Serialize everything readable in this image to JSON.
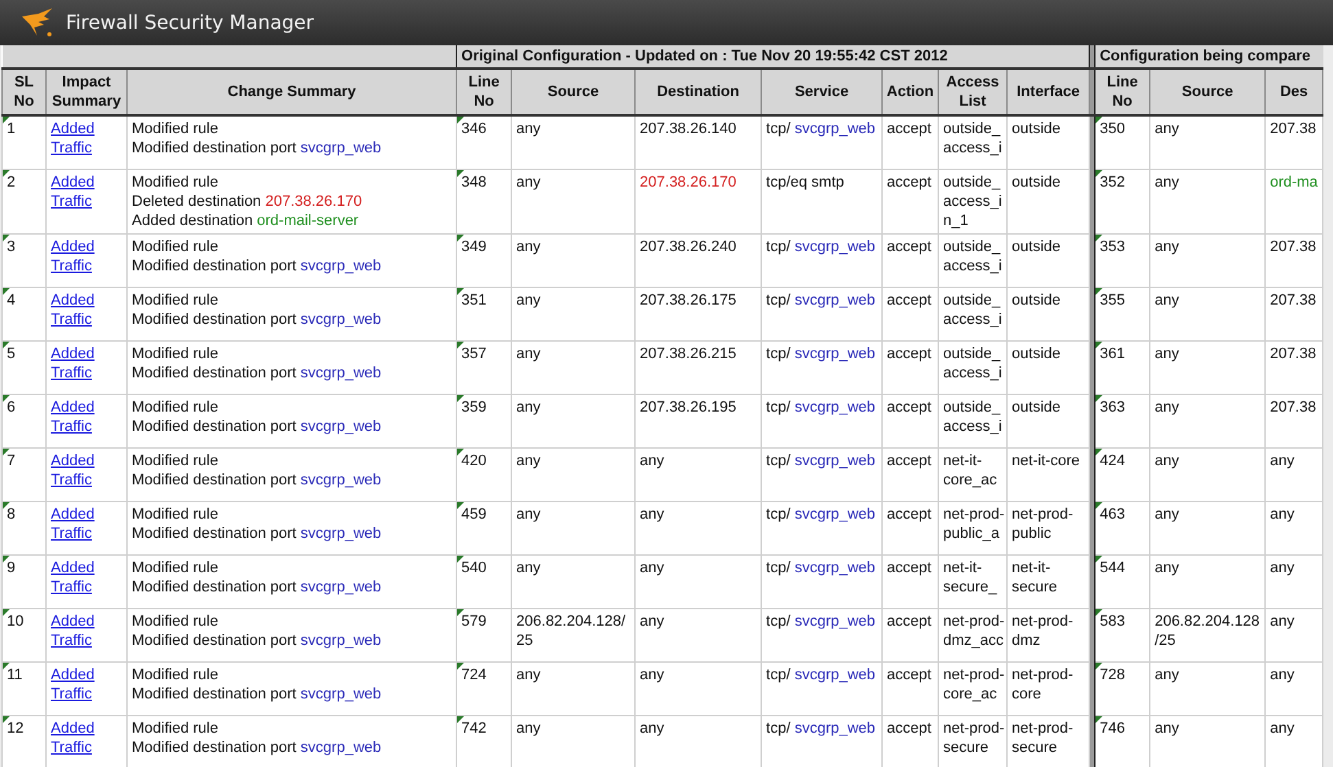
{
  "window": {
    "title": "Firewall Security Manager"
  },
  "groups": [
    {
      "label": "Original Configuration - Updated on : Tue Nov 20 19:55:42 CST 2012"
    },
    {
      "label": "Configuration being compare"
    }
  ],
  "columns": [
    "SL No",
    "Impact Summary",
    "Change Summary",
    "Line No",
    "Source",
    "Destination",
    "Service",
    "Action",
    "Access List",
    "Interface",
    "Line No",
    "Source",
    "Des"
  ],
  "rows": [
    {
      "sl": "1",
      "impact": "Added Traffic",
      "summary": [
        {
          "text": "Modified rule"
        },
        {
          "text": "Modified destination port ",
          "value": "svcgrp_web",
          "kind": "object"
        }
      ],
      "line": "346",
      "source": "any",
      "destination": {
        "text": "207.38.26.140",
        "kind": "plain"
      },
      "service": {
        "text": "tcp/ ",
        "value": "svcgrp_web"
      },
      "action": "accept",
      "access_list": "outside_access_i",
      "interface": "outside",
      "cmp_line": "350",
      "cmp_source": "any",
      "cmp_destination": {
        "text": "207.38",
        "kind": "plain"
      }
    },
    {
      "sl": "2",
      "impact": "Added Traffic",
      "summary": [
        {
          "text": "Modified rule"
        },
        {
          "text": "Deleted destination ",
          "value": "207.38.26.170",
          "kind": "deleted"
        },
        {
          "text": "Added destination ",
          "value": "ord-mail-server",
          "kind": "added"
        }
      ],
      "line": "348",
      "source": "any",
      "destination": {
        "text": "207.38.26.170",
        "kind": "deleted"
      },
      "service": {
        "text": "tcp/eq smtp"
      },
      "action": "accept",
      "access_list": "outside_access_in_1",
      "interface": "outside",
      "cmp_line": "352",
      "cmp_source": "any",
      "cmp_destination": {
        "text": "ord-ma",
        "kind": "added"
      }
    },
    {
      "sl": "3",
      "impact": "Added Traffic",
      "summary": [
        {
          "text": "Modified rule"
        },
        {
          "text": "Modified destination port ",
          "value": "svcgrp_web",
          "kind": "object"
        }
      ],
      "line": "349",
      "source": "any",
      "destination": {
        "text": "207.38.26.240",
        "kind": "plain"
      },
      "service": {
        "text": "tcp/ ",
        "value": "svcgrp_web"
      },
      "action": "accept",
      "access_list": "outside_access_i",
      "interface": "outside",
      "cmp_line": "353",
      "cmp_source": "any",
      "cmp_destination": {
        "text": "207.38",
        "kind": "plain"
      }
    },
    {
      "sl": "4",
      "impact": "Added Traffic",
      "summary": [
        {
          "text": "Modified rule"
        },
        {
          "text": "Modified destination port ",
          "value": "svcgrp_web",
          "kind": "object"
        }
      ],
      "line": "351",
      "source": "any",
      "destination": {
        "text": "207.38.26.175",
        "kind": "plain"
      },
      "service": {
        "text": "tcp/ ",
        "value": "svcgrp_web"
      },
      "action": "accept",
      "access_list": "outside_access_i",
      "interface": "outside",
      "cmp_line": "355",
      "cmp_source": "any",
      "cmp_destination": {
        "text": "207.38",
        "kind": "plain"
      }
    },
    {
      "sl": "5",
      "impact": "Added Traffic",
      "summary": [
        {
          "text": "Modified rule"
        },
        {
          "text": "Modified destination port ",
          "value": "svcgrp_web",
          "kind": "object"
        }
      ],
      "line": "357",
      "source": "any",
      "destination": {
        "text": "207.38.26.215",
        "kind": "plain"
      },
      "service": {
        "text": "tcp/ ",
        "value": "svcgrp_web"
      },
      "action": "accept",
      "access_list": "outside_access_i",
      "interface": "outside",
      "cmp_line": "361",
      "cmp_source": "any",
      "cmp_destination": {
        "text": "207.38",
        "kind": "plain"
      }
    },
    {
      "sl": "6",
      "impact": "Added Traffic",
      "summary": [
        {
          "text": "Modified rule"
        },
        {
          "text": "Modified destination port ",
          "value": "svcgrp_web",
          "kind": "object"
        }
      ],
      "line": "359",
      "source": "any",
      "destination": {
        "text": "207.38.26.195",
        "kind": "plain"
      },
      "service": {
        "text": "tcp/ ",
        "value": "svcgrp_web"
      },
      "action": "accept",
      "access_list": "outside_access_i",
      "interface": "outside",
      "cmp_line": "363",
      "cmp_source": "any",
      "cmp_destination": {
        "text": "207.38",
        "kind": "plain"
      }
    },
    {
      "sl": "7",
      "impact": "Added Traffic",
      "summary": [
        {
          "text": "Modified rule"
        },
        {
          "text": "Modified destination port ",
          "value": "svcgrp_web",
          "kind": "object"
        }
      ],
      "line": "420",
      "source": "any",
      "destination": {
        "text": "any",
        "kind": "plain"
      },
      "service": {
        "text": "tcp/ ",
        "value": "svcgrp_web"
      },
      "action": "accept",
      "access_list": "net-it-core_ac",
      "interface": "net-it-core",
      "cmp_line": "424",
      "cmp_source": "any",
      "cmp_destination": {
        "text": "any",
        "kind": "plain"
      }
    },
    {
      "sl": "8",
      "impact": "Added Traffic",
      "summary": [
        {
          "text": "Modified rule"
        },
        {
          "text": "Modified destination port ",
          "value": "svcgrp_web",
          "kind": "object"
        }
      ],
      "line": "459",
      "source": "any",
      "destination": {
        "text": "any",
        "kind": "plain"
      },
      "service": {
        "text": "tcp/ ",
        "value": "svcgrp_web"
      },
      "action": "accept",
      "access_list": "net-prod-public_a",
      "interface": "net-prod-public",
      "cmp_line": "463",
      "cmp_source": "any",
      "cmp_destination": {
        "text": "any",
        "kind": "plain"
      }
    },
    {
      "sl": "9",
      "impact": "Added Traffic",
      "summary": [
        {
          "text": "Modified rule"
        },
        {
          "text": "Modified destination port ",
          "value": "svcgrp_web",
          "kind": "object"
        }
      ],
      "line": "540",
      "source": "any",
      "destination": {
        "text": "any",
        "kind": "plain"
      },
      "service": {
        "text": "tcp/ ",
        "value": "svcgrp_web"
      },
      "action": "accept",
      "access_list": "net-it-secure_",
      "interface": "net-it-secure",
      "cmp_line": "544",
      "cmp_source": "any",
      "cmp_destination": {
        "text": "any",
        "kind": "plain"
      }
    },
    {
      "sl": "10",
      "impact": "Added Traffic",
      "summary": [
        {
          "text": "Modified rule"
        },
        {
          "text": "Modified destination port ",
          "value": "svcgrp_web",
          "kind": "object"
        }
      ],
      "line": "579",
      "source": "206.82.204.128/25",
      "destination": {
        "text": "any",
        "kind": "plain"
      },
      "service": {
        "text": "tcp/ ",
        "value": "svcgrp_web"
      },
      "action": "accept",
      "access_list": "net-prod-dmz_acc",
      "interface": "net-prod-dmz",
      "cmp_line": "583",
      "cmp_source": "206.82.204.128/25",
      "cmp_destination": {
        "text": "any",
        "kind": "plain"
      }
    },
    {
      "sl": "11",
      "impact": "Added Traffic",
      "summary": [
        {
          "text": "Modified rule"
        },
        {
          "text": "Modified destination port ",
          "value": "svcgrp_web",
          "kind": "object"
        }
      ],
      "line": "724",
      "source": "any",
      "destination": {
        "text": "any",
        "kind": "plain"
      },
      "service": {
        "text": "tcp/ ",
        "value": "svcgrp_web"
      },
      "action": "accept",
      "access_list": "net-prod-core_ac",
      "interface": "net-prod-core",
      "cmp_line": "728",
      "cmp_source": "any",
      "cmp_destination": {
        "text": "any",
        "kind": "plain"
      }
    },
    {
      "sl": "12",
      "impact": "Added Traffic",
      "summary": [
        {
          "text": "Modified rule"
        },
        {
          "text": "Modified destination port ",
          "value": "svcgrp_web",
          "kind": "object"
        }
      ],
      "line": "742",
      "source": "any",
      "destination": {
        "text": "any",
        "kind": "plain"
      },
      "service": {
        "text": "tcp/ ",
        "value": "svcgrp_web"
      },
      "action": "accept",
      "access_list": "net-prod-secure",
      "interface": "net-prod-secure",
      "cmp_line": "746",
      "cmp_source": "any",
      "cmp_destination": {
        "text": "any",
        "kind": "plain"
      }
    }
  ]
}
